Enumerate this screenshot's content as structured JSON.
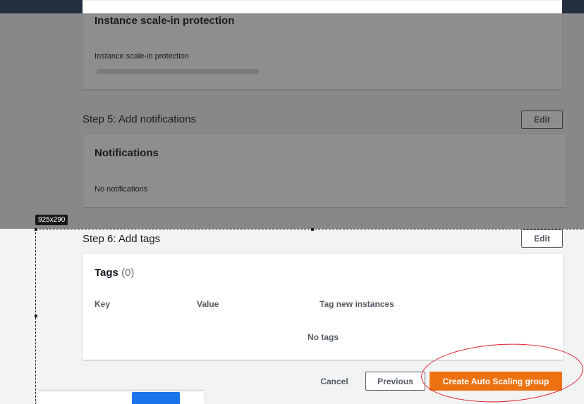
{
  "step4": {
    "card_title": "Instance scale-in protection",
    "field_label": "Instance scale-in protection"
  },
  "step5": {
    "title": "Step 5: Add notifications",
    "edit_label": "Edit",
    "card_title": "Notifications",
    "empty_text": "No notifications"
  },
  "selection": {
    "dimensions": "925x290"
  },
  "step6": {
    "title": "Step 6: Add tags",
    "edit_label": "Edit",
    "card_title": "Tags",
    "count": "(0)",
    "columns": [
      "Key",
      "Value",
      "Tag new instances"
    ],
    "empty_text": "No tags"
  },
  "footer": {
    "cancel_label": "Cancel",
    "previous_label": "Previous",
    "create_label": "Create Auto Scaling group"
  },
  "colors": {
    "primary": "#ec7211",
    "annotation": "#e0202a",
    "topbar": "#232f3e"
  }
}
